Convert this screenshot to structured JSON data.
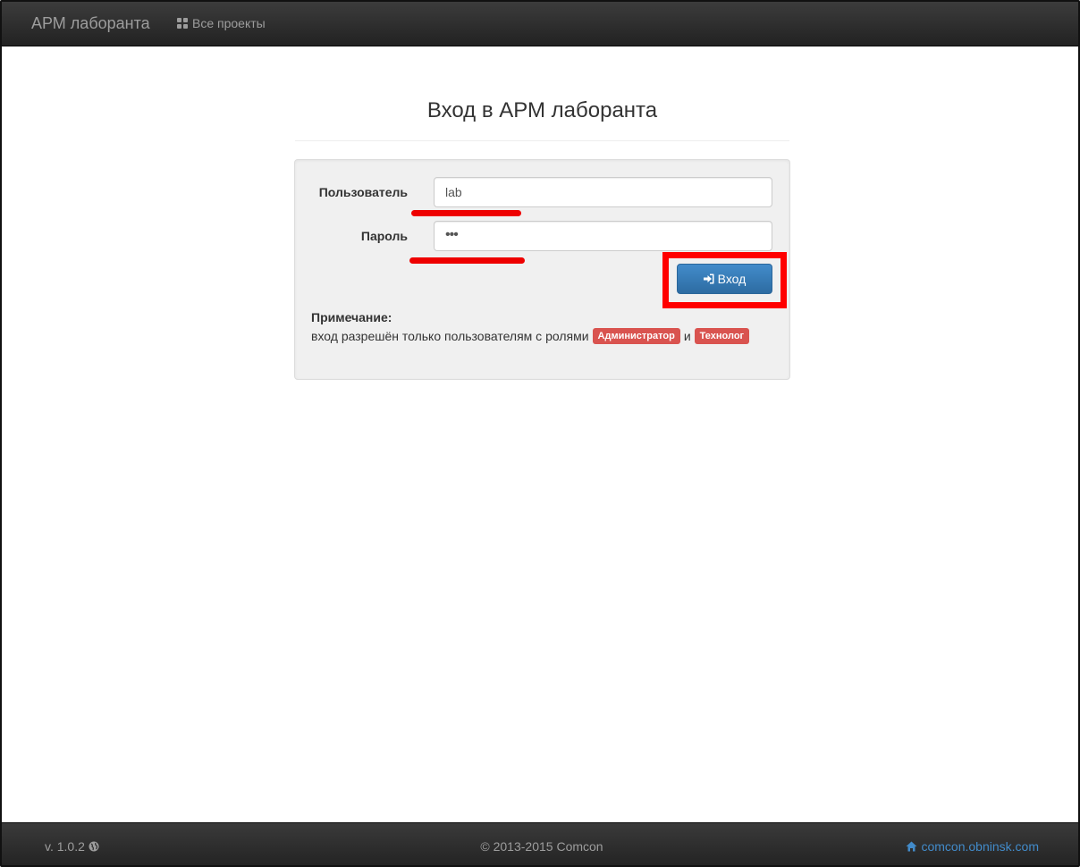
{
  "navbar": {
    "brand": "АРМ лаборанта",
    "projects_label": "Все проекты",
    "projects_icon": "grid-icon"
  },
  "page": {
    "title": "Вход в АРМ лаборанта"
  },
  "form": {
    "user_label": "Пользователь",
    "user_value": "lab",
    "password_label": "Пароль",
    "password_value": "•••",
    "submit_label": "Вход",
    "submit_icon": "login-icon"
  },
  "note": {
    "title": "Примечание:",
    "text": "вход разрешён только пользователям с ролями",
    "role_admin": "Администратор",
    "conjunction": "и",
    "role_tech": "Технолог"
  },
  "footer": {
    "version": "v. 1.0.2",
    "version_icon": "globe-icon",
    "copyright": "© 2013-2015 Comcon",
    "site": "comcon.obninsk.com",
    "site_icon": "home-icon"
  },
  "colors": {
    "primary": "#428bca",
    "danger": "#d9534f",
    "annotation": "#ff0000"
  }
}
